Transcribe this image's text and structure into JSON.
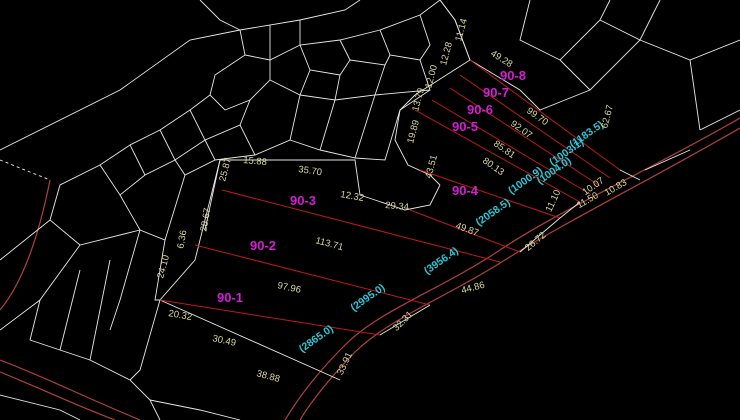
{
  "lots": [
    {
      "id": "90-8",
      "area": "(1183.5)"
    },
    {
      "id": "90-7",
      "area": "(1003.1)"
    },
    {
      "id": "90-6",
      "area": "(1004.0)"
    },
    {
      "id": "90-5",
      "area": "(1000.9)"
    },
    {
      "id": "90-4",
      "area": "(2058.5)"
    },
    {
      "id": "90-3",
      "area": "(3956.4)"
    },
    {
      "id": "90-2",
      "area": "(2995.0)"
    },
    {
      "id": "90-1",
      "area": "(2865.0)"
    }
  ],
  "dimensions": {
    "d_11_14": "11.14",
    "d_12_28": "12.28",
    "d_49_28": "49.28",
    "d_12_00": "12.00",
    "d_13_79": "13.79",
    "d_99_70": "99.70",
    "d_92_07": "92.07",
    "d_62_67": "62.67",
    "d_19_89": "19.89",
    "d_85_81": "85.81",
    "d_80_13": "80.13",
    "d_43_51": "43.51",
    "d_10_07": "10.07",
    "d_11_50": "11.50",
    "d_10_83": "10.83",
    "d_11_10": "11.10",
    "d_25_87": "25.87",
    "d_15_88": "15.88",
    "d_35_70": "35.70",
    "d_12_32": "12.32",
    "d_29_34": "29.34",
    "d_49_87": "49.87",
    "d_26_72": "26.72",
    "d_28_67": "28.67",
    "d_6_36": "6.36",
    "d_113_71": "113.71",
    "d_24_10": "24.10",
    "d_44_86": "44.86",
    "d_97_96": "97.96",
    "d_32_31": "32.31",
    "d_20_32": "20.32",
    "d_30_49": "30.49",
    "d_33_91": "33.91",
    "d_38_88": "38.88"
  }
}
